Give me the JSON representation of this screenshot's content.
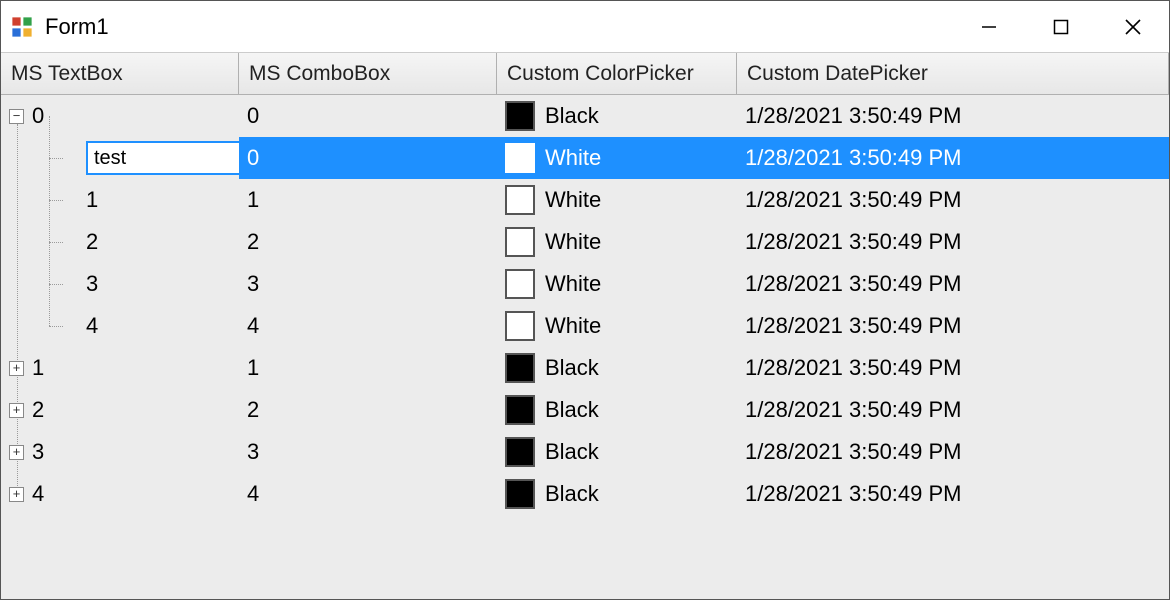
{
  "window": {
    "title": "Form1"
  },
  "columns": [
    {
      "label": "MS TextBox"
    },
    {
      "label": "MS ComboBox"
    },
    {
      "label": "Custom ColorPicker"
    },
    {
      "label": "Custom DatePicker"
    }
  ],
  "rows": [
    {
      "level": 0,
      "expander": "minus",
      "label": "0",
      "combo": "0",
      "color_name": "Black",
      "swatch": "black",
      "date": "1/28/2021 3:50:49 PM",
      "editing": false,
      "selected": false
    },
    {
      "level": 1,
      "expander": "none",
      "label": "test",
      "combo": "0",
      "color_name": "White",
      "swatch": "white",
      "date": "1/28/2021 3:50:49 PM",
      "editing": true,
      "selected": true
    },
    {
      "level": 1,
      "expander": "none",
      "label": "1",
      "combo": "1",
      "color_name": "White",
      "swatch": "white",
      "date": "1/28/2021 3:50:49 PM",
      "editing": false,
      "selected": false
    },
    {
      "level": 1,
      "expander": "none",
      "label": "2",
      "combo": "2",
      "color_name": "White",
      "swatch": "white",
      "date": "1/28/2021 3:50:49 PM",
      "editing": false,
      "selected": false
    },
    {
      "level": 1,
      "expander": "none",
      "label": "3",
      "combo": "3",
      "color_name": "White",
      "swatch": "white",
      "date": "1/28/2021 3:50:49 PM",
      "editing": false,
      "selected": false
    },
    {
      "level": 1,
      "expander": "none",
      "label": "4",
      "combo": "4",
      "color_name": "White",
      "swatch": "white",
      "date": "1/28/2021 3:50:49 PM",
      "editing": false,
      "selected": false
    },
    {
      "level": 0,
      "expander": "plus",
      "label": "1",
      "combo": "1",
      "color_name": "Black",
      "swatch": "black",
      "date": "1/28/2021 3:50:49 PM",
      "editing": false,
      "selected": false
    },
    {
      "level": 0,
      "expander": "plus",
      "label": "2",
      "combo": "2",
      "color_name": "Black",
      "swatch": "black",
      "date": "1/28/2021 3:50:49 PM",
      "editing": false,
      "selected": false
    },
    {
      "level": 0,
      "expander": "plus",
      "label": "3",
      "combo": "3",
      "color_name": "Black",
      "swatch": "black",
      "date": "1/28/2021 3:50:49 PM",
      "editing": false,
      "selected": false
    },
    {
      "level": 0,
      "expander": "plus",
      "label": "4",
      "combo": "4",
      "color_name": "Black",
      "swatch": "black",
      "date": "1/28/2021 3:50:49 PM",
      "editing": false,
      "selected": false
    }
  ]
}
